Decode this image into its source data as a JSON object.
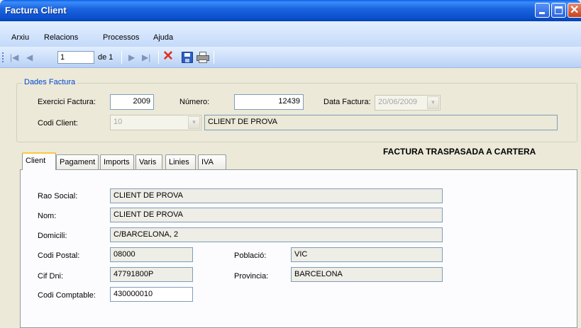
{
  "window": {
    "title": "Factura Client"
  },
  "menu": [
    "Arxiu",
    "Relacions",
    "Processos",
    "Ajuda"
  ],
  "toolbar": {
    "position": "1",
    "of_label": "de 1"
  },
  "dades": {
    "legend": "Dades Factura",
    "exercici_label": "Exercici Factura:",
    "exercici_value": "2009",
    "numero_label": "Número:",
    "numero_value": "12439",
    "data_label": "Data Factura:",
    "data_value": "20/06/2009",
    "codi_client_label": "Codi Client:",
    "codi_client_value": "10",
    "client_name": "CLIENT DE PROVA"
  },
  "status": "FACTURA TRASPASADA A CARTERA",
  "tabs": [
    "Client",
    "Pagament",
    "Imports",
    "Varis",
    "Linies",
    "IVA"
  ],
  "client": {
    "rao_social_label": "Rao Social:",
    "rao_social": "CLIENT DE PROVA",
    "nom_label": "Nom:",
    "nom": "CLIENT DE PROVA",
    "domicili_label": "Domicili:",
    "domicili": "C/BARCELONA, 2",
    "codi_postal_label": "Codi Postal:",
    "codi_postal": "08000",
    "poblacio_label": "Població:",
    "poblacio": "VIC",
    "cif_label": "Cif Dni:",
    "cif": "47791800P",
    "provincia_label": "Provincia:",
    "provincia": "BARCELONA",
    "codi_comptable_label": "Codi Comptable:",
    "codi_comptable": "430000010"
  }
}
